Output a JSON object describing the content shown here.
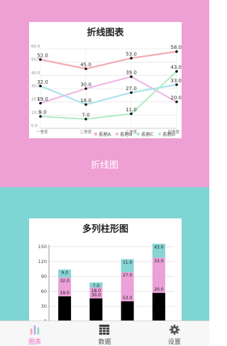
{
  "colors": {
    "pink_bg": "#ee9fd4",
    "teal_bg": "#7fd4d4",
    "series_a": "#f2aab0",
    "series_b": "#efb8e1",
    "series_c": "#a9e2ea",
    "series_d": "#b6ecc6",
    "stack_black": "#000000",
    "stack_pink": "#eba0d8",
    "stack_teal": "#86d4d4",
    "tab_active": "#ee6fbf"
  },
  "line_section": {
    "caption": "折线图",
    "chart_data": {
      "type": "line",
      "title": "折线图表",
      "categories": [
        "一季度",
        "二季度",
        "三季度",
        "四季度"
      ],
      "ylim": [
        0,
        60
      ],
      "yticks": [
        "0.0",
        "10.0",
        "20.0",
        "30.0",
        "40.0",
        "50.0",
        "60.0"
      ],
      "grid": true,
      "legend_position": "bottom-right",
      "series": [
        {
          "name": "名称A",
          "values": [
            52,
            45,
            53,
            58
          ],
          "labels": [
            "52.0",
            "45.0",
            "53.0",
            "58.0"
          ],
          "color": "#f2aab0"
        },
        {
          "name": "名称B",
          "values": [
            19,
            30,
            39,
            20
          ],
          "labels": [
            "19.0",
            "30.0",
            "39.0",
            "20.0"
          ],
          "color": "#efb8e1"
        },
        {
          "name": "名称C",
          "values": [
            32,
            18,
            27,
            33
          ],
          "labels": [
            "32.0",
            "18.0",
            "27.0",
            "33.0"
          ],
          "color": "#a9e2ea"
        },
        {
          "name": "名称D",
          "values": [
            9,
            7,
            11,
            43
          ],
          "labels": [
            "9.0",
            "7.0",
            "11.0",
            "43.0"
          ],
          "color": "#b6ecc6"
        }
      ]
    }
  },
  "bar_section": {
    "chart_data": {
      "type": "bar",
      "title": "多列柱形图",
      "stacked": true,
      "ylim": [
        0,
        150
      ],
      "yticks": [
        "0",
        "30",
        "60",
        "90",
        "120",
        "150"
      ],
      "grid": true,
      "categories": [
        "",
        "",
        "",
        ""
      ],
      "segments": [
        {
          "values": [
            50,
            46,
            40,
            57
          ],
          "color": "#000000",
          "labels": [
            "19.0",
            "30.0",
            "53.0",
            "20.0"
          ]
        },
        {
          "values": [
            38,
            22,
            59,
            71
          ],
          "color": "#eba0d8",
          "labels": [
            "32.0",
            "18.0",
            "27.0",
            "33.0"
          ]
        },
        {
          "values": [
            16,
            10,
            26,
            28
          ],
          "color": "#86d4d4",
          "labels": [
            "9.0",
            "7.0",
            "11.0",
            "43.0"
          ]
        }
      ]
    }
  },
  "tabbar": {
    "tabs": [
      {
        "label": "图表",
        "icon": "bar-chart-icon",
        "active": true
      },
      {
        "label": "数据",
        "icon": "table-grid-icon",
        "active": false
      },
      {
        "label": "设置",
        "icon": "gear-icon",
        "active": false
      }
    ]
  }
}
